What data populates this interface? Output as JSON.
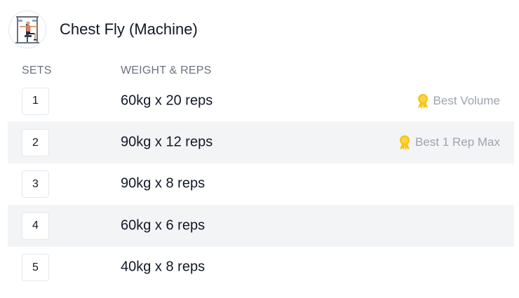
{
  "exercise": {
    "title": "Chest Fly (Machine)",
    "image_icon": "chest-fly-machine-thumbnail"
  },
  "table": {
    "headers": {
      "sets": "SETS",
      "weight_reps": "WEIGHT & REPS"
    },
    "rows": [
      {
        "set": "1",
        "weight_reps": "60kg x 20 reps",
        "badge": "Best Volume"
      },
      {
        "set": "2",
        "weight_reps": "90kg x 12 reps",
        "badge": "Best 1 Rep Max"
      },
      {
        "set": "3",
        "weight_reps": "90kg x 8 reps",
        "badge": ""
      },
      {
        "set": "4",
        "weight_reps": "60kg x 6 reps",
        "badge": ""
      },
      {
        "set": "5",
        "weight_reps": "40kg x 8 reps",
        "badge": ""
      }
    ]
  },
  "colors": {
    "text_primary": "#111827",
    "text_muted": "#6b7280",
    "badge_text": "#9ca3af",
    "medal": "#f5c518",
    "alt_row_bg": "#f3f4f6"
  }
}
